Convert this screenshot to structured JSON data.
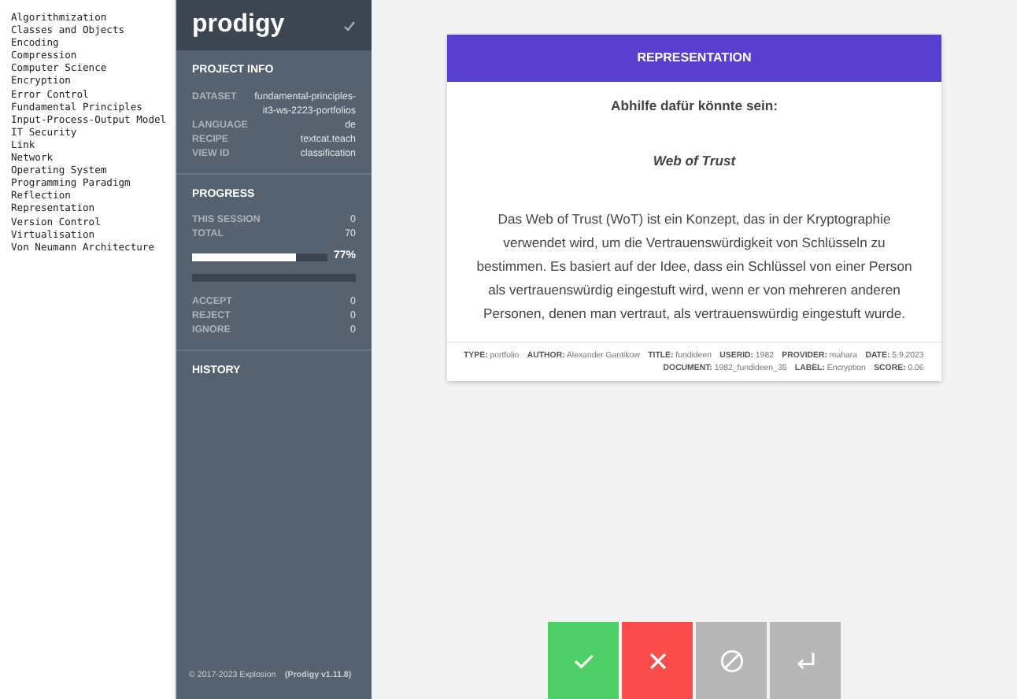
{
  "label_list": [
    "Algorithmization",
    "Classes and Objects",
    "Encoding",
    "Compression",
    "Computer Science",
    "Encryption",
    "Error Control",
    "Fundamental Principles",
    "Input-Process-Output Model",
    "IT Security",
    "Link",
    "Network",
    "Operating System",
    "Programming Paradigm",
    "Reflection",
    "Representation",
    "Version Control",
    "Virtualisation",
    "Von Neumann Architecture"
  ],
  "sidebar": {
    "logo": "prodigy",
    "project_info": {
      "title": "PROJECT INFO",
      "rows": [
        {
          "key": "DATASET",
          "value": "fundamental-principles-it3-ws-2223-portfolios"
        },
        {
          "key": "LANGUAGE",
          "value": "de"
        },
        {
          "key": "RECIPE",
          "value": "textcat.teach"
        },
        {
          "key": "VIEW ID",
          "value": "classification"
        }
      ]
    },
    "progress": {
      "title": "PROGRESS",
      "rows": [
        {
          "key": "THIS SESSION",
          "value": "0"
        },
        {
          "key": "TOTAL",
          "value": "70"
        }
      ],
      "bars": [
        {
          "level": 0.77,
          "reading": "77%"
        },
        {
          "level": 0
        }
      ],
      "counts": [
        {
          "key": "ACCEPT",
          "value": "0"
        },
        {
          "key": "REJECT",
          "value": "0"
        },
        {
          "key": "IGNORE",
          "value": "0"
        }
      ]
    },
    "history": {
      "title": "HISTORY"
    },
    "footer": {
      "copyright": "© 2017-2023 Explosion",
      "version": "(Prodigy v1.11.8)"
    }
  },
  "card": {
    "label": "REPRESENTATION",
    "heading": "Abhilfe dafür könnte sein:",
    "subtitle": "Web of Trust",
    "body": "Das Web of Trust (WoT) ist ein Konzept, das in der Kryptographie verwendet wird, um die Vertrauenswürdigkeit von Schlüsseln zu bestimmen. Es basiert auf der Idee, dass ein Schlüssel von einer Person als vertrauenswürdig eingestuft wird, wenn er von mehreren anderen Personen, denen man vertraut, als vertrauenswürdig eingestuft wurde.",
    "meta": [
      {
        "key": "TYPE:",
        "value": "portfolio"
      },
      {
        "key": "AUTHOR:",
        "value": "Alexander Gantikow"
      },
      {
        "key": "TITLE:",
        "value": "fundideen"
      },
      {
        "key": "USERID:",
        "value": "1982"
      },
      {
        "key": "PROVIDER:",
        "value": "mahara"
      },
      {
        "key": "DATE:",
        "value": "5.9.2023"
      },
      {
        "key": "DOCUMENT:",
        "value": "1982_fundideen_35"
      },
      {
        "key": "LABEL:",
        "value": "Encryption"
      },
      {
        "key": "SCORE:",
        "value": "0.06"
      }
    ]
  },
  "actions": [
    {
      "kind": "accept"
    },
    {
      "kind": "reject"
    },
    {
      "kind": "ignore"
    },
    {
      "kind": "undo"
    }
  ]
}
